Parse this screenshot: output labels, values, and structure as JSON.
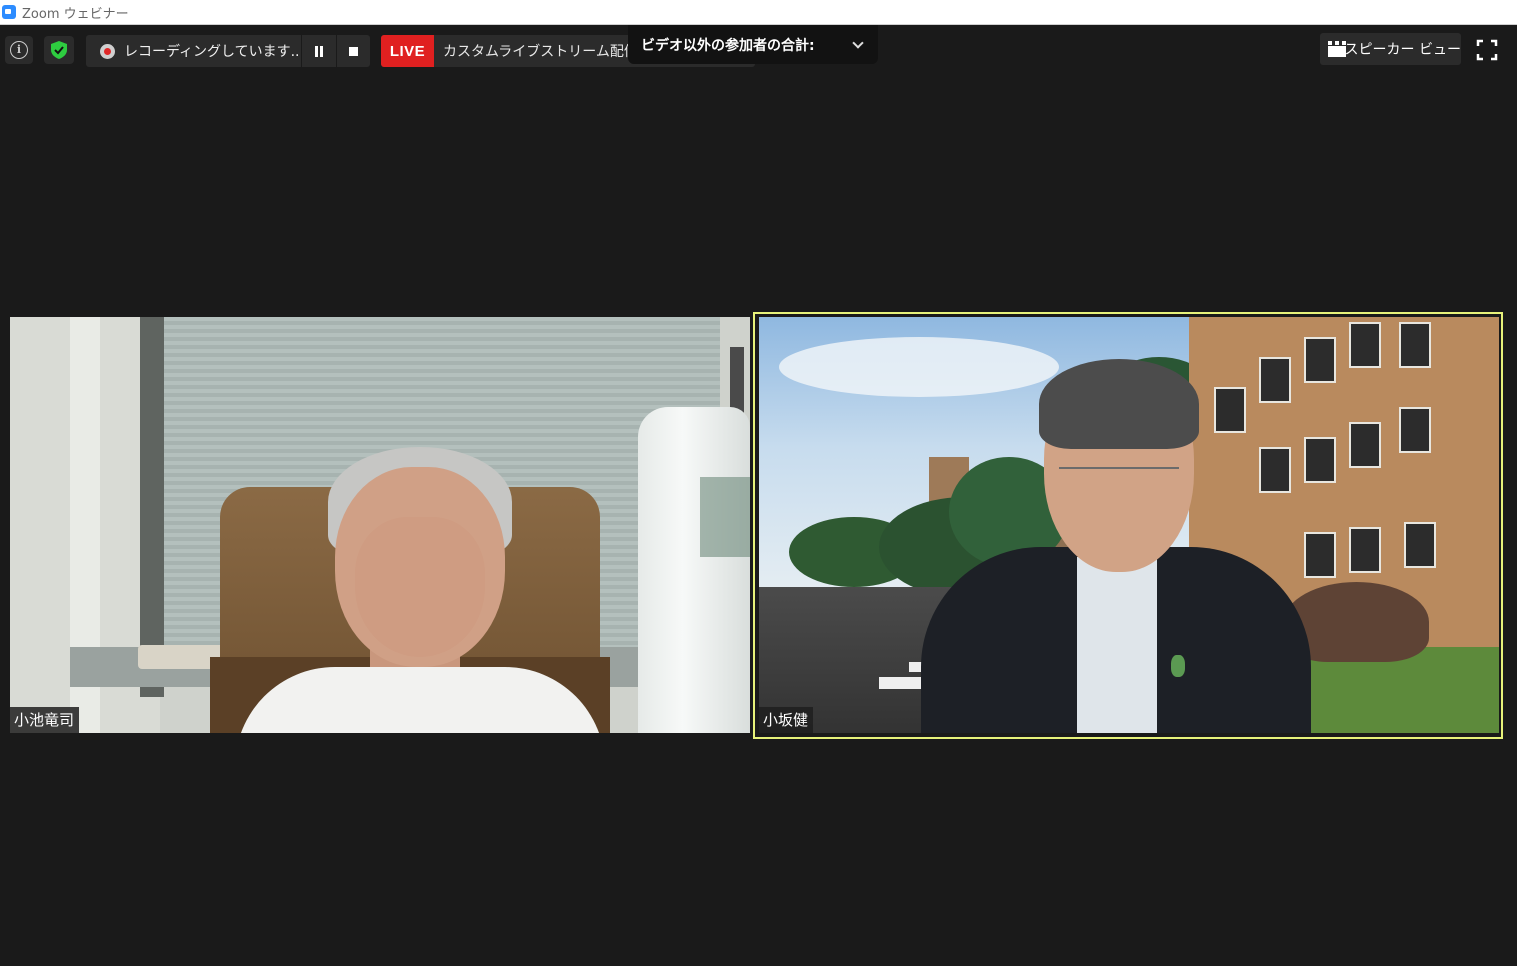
{
  "window": {
    "title": "Zoom ウェビナー"
  },
  "toolbar": {
    "recording_label": "レコーディングしています...",
    "live_badge": "LIVE",
    "live_text": "カスタムライブストリーム配信サービスに参加中",
    "participants_label": "ビデオ以外の参加者の合計:",
    "speaker_view_label": "スピーカー ビュー"
  },
  "participants": [
    {
      "name": "小池竜司",
      "active_speaker": false
    },
    {
      "name": "小坂健",
      "active_speaker": true
    }
  ],
  "colors": {
    "background": "#1a1a1a",
    "live_red": "#e02020",
    "active_speaker_border": "#e7f27a",
    "shield_green": "#2ecc40"
  },
  "icons": {
    "info": "info-icon",
    "shield": "shield-check-icon",
    "record": "record-icon",
    "pause": "pause-icon",
    "stop": "stop-icon",
    "chevron": "chevron-down-icon",
    "grid": "grid-icon",
    "fullscreen": "fullscreen-icon"
  }
}
